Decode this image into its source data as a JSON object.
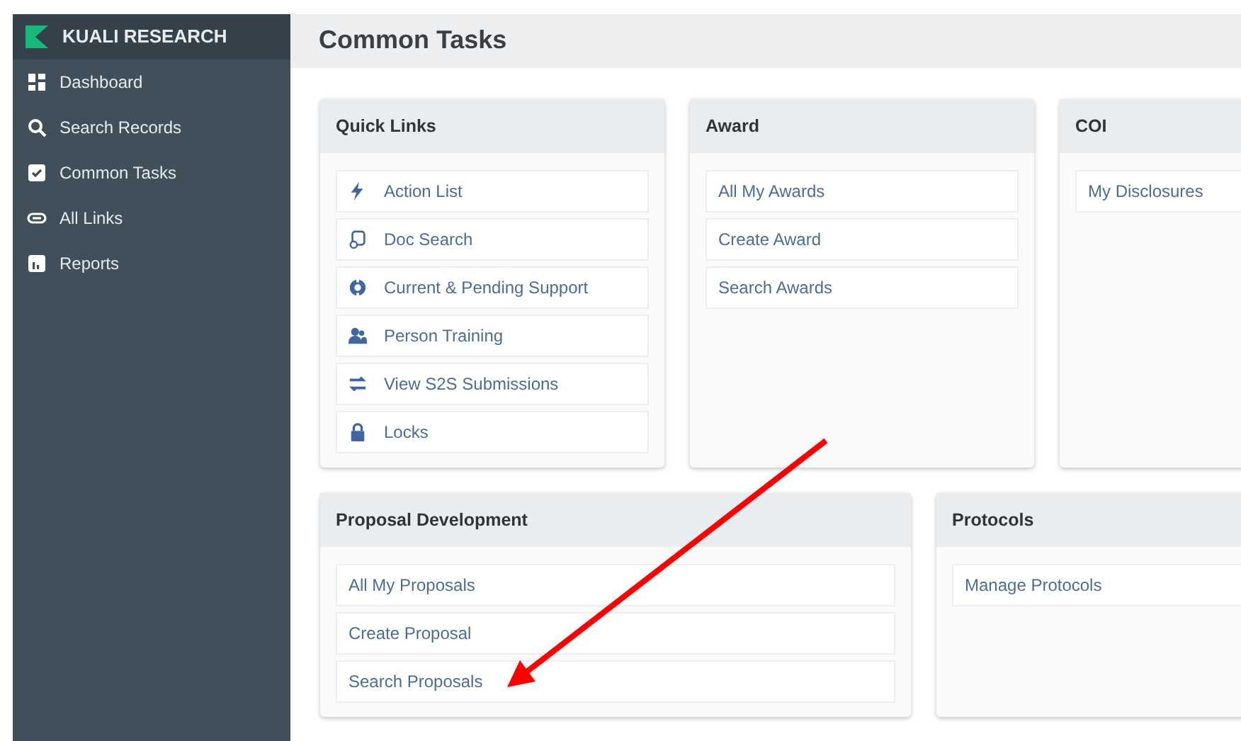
{
  "sidebar": {
    "brand": "KUALI RESEARCH",
    "items": [
      {
        "label": "Dashboard"
      },
      {
        "label": "Search Records"
      },
      {
        "label": "Common Tasks"
      },
      {
        "label": "All Links"
      },
      {
        "label": "Reports"
      }
    ]
  },
  "page_title": "Common Tasks",
  "rows": [
    {
      "cards": [
        {
          "title": "Quick Links",
          "links": [
            {
              "label": "Action List"
            },
            {
              "label": "Doc Search"
            },
            {
              "label": "Current & Pending Support"
            },
            {
              "label": "Person Training"
            },
            {
              "label": "View S2S Submissions"
            },
            {
              "label": "Locks"
            }
          ]
        },
        {
          "title": "Award",
          "links": [
            {
              "label": "All My Awards"
            },
            {
              "label": "Create Award"
            },
            {
              "label": "Search Awards"
            }
          ]
        },
        {
          "title": "COI",
          "links": [
            {
              "label": "My Disclosures"
            }
          ]
        }
      ]
    },
    {
      "cards": [
        {
          "title": "Proposal Development",
          "links": [
            {
              "label": "All My Proposals"
            },
            {
              "label": "Create Proposal"
            },
            {
              "label": "Search Proposals"
            }
          ]
        },
        {
          "title": "Protocols",
          "links": [
            {
              "label": "Manage Protocols"
            }
          ]
        }
      ]
    }
  ]
}
